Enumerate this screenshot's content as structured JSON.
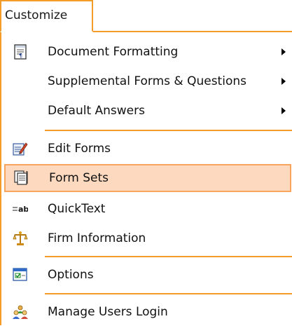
{
  "menu": {
    "title": "Customize",
    "items": [
      {
        "id": "document-formatting",
        "label": "Document Formatting",
        "icon": "document-formatting-icon",
        "submenu": true
      },
      {
        "id": "supplemental-forms",
        "label": "Supplemental Forms & Questions",
        "submenu": true
      },
      {
        "id": "default-answers",
        "label": "Default Answers",
        "submenu": true
      },
      {
        "id": "edit-forms",
        "label": "Edit Forms",
        "icon": "edit-forms-icon"
      },
      {
        "id": "form-sets",
        "label": "Form Sets",
        "icon": "form-sets-icon",
        "highlighted": true
      },
      {
        "id": "quicktext",
        "label": "QuickText",
        "icon": "quicktext-icon"
      },
      {
        "id": "firm-information",
        "label": "Firm Information",
        "icon": "scales-icon"
      },
      {
        "id": "options",
        "label": "Options",
        "icon": "options-icon"
      },
      {
        "id": "manage-users-login",
        "label": "Manage Users Login",
        "icon": "users-icon"
      }
    ]
  },
  "colors": {
    "accent": "#f39c2a",
    "highlight_fill": "#fcd9bf",
    "highlight_border": "#f7a55c"
  }
}
